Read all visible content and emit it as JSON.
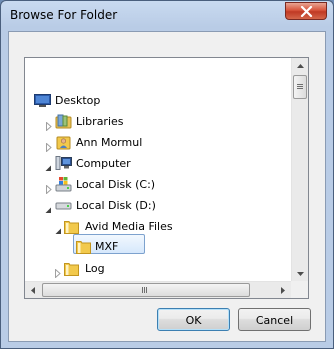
{
  "window": {
    "title": "Browse For Folder"
  },
  "tree": {
    "items": [
      {
        "label": "Desktop",
        "icon": "desktop-icon",
        "expander": "none"
      },
      {
        "label": "Libraries",
        "icon": "libraries-icon",
        "expander": "collapsed"
      },
      {
        "label": "Ann Mormul",
        "icon": "user-folder-icon",
        "expander": "collapsed"
      },
      {
        "label": "Computer",
        "icon": "computer-icon",
        "expander": "expanded"
      },
      {
        "label": "Local Disk (C:)",
        "icon": "windows-drive-icon",
        "expander": "collapsed"
      },
      {
        "label": "Local Disk (D:)",
        "icon": "drive-icon",
        "expander": "expanded"
      },
      {
        "label": "Avid Media Files",
        "icon": "folder-icon",
        "expander": "expanded"
      },
      {
        "label": "MXF",
        "icon": "folder-icon",
        "expander": "none",
        "selected": true
      },
      {
        "label": "Log",
        "icon": "folder-icon",
        "expander": "collapsed"
      }
    ]
  },
  "buttons": {
    "ok": "OK",
    "cancel": "Cancel"
  },
  "colors": {
    "selection_border": "#7da2ce",
    "folder_yellow": "#f2c94c",
    "close_red": "#c9452e"
  }
}
